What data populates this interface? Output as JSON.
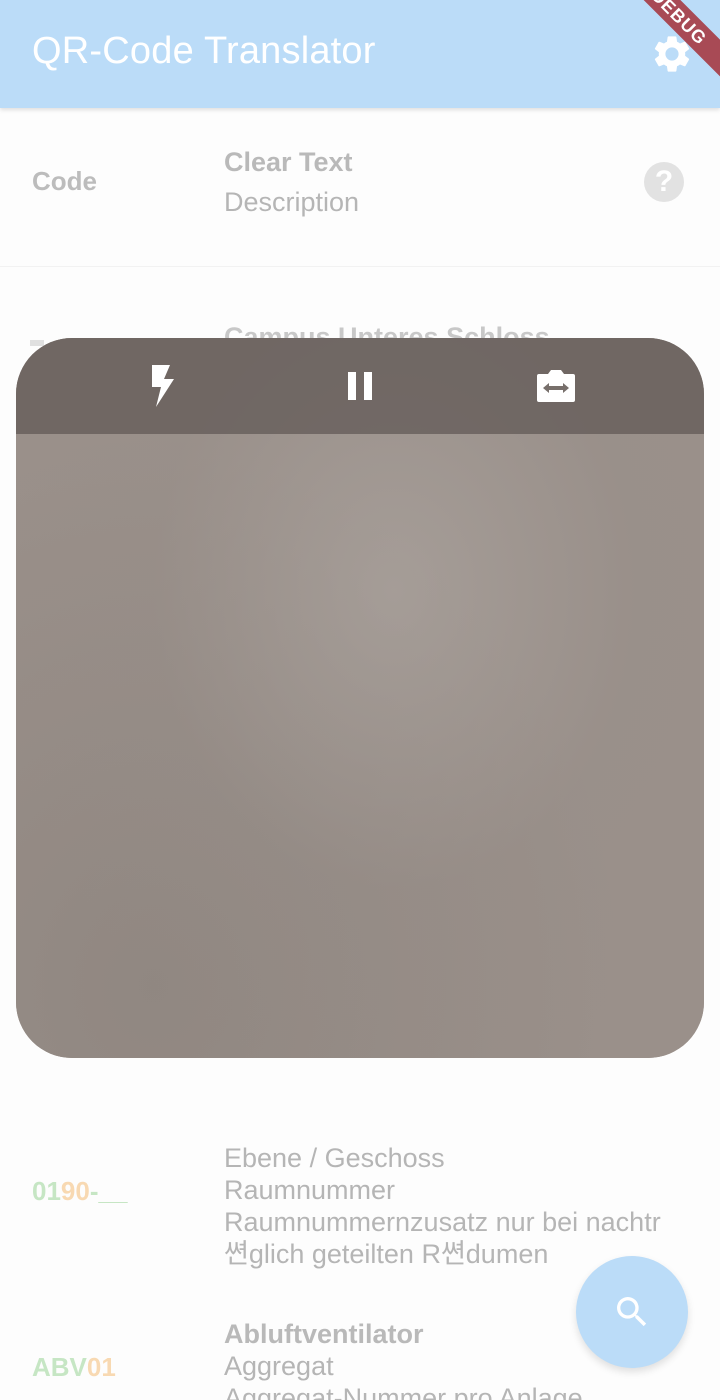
{
  "appbar": {
    "title": "QR-Code Translator",
    "settings_icon": "gear-icon",
    "debug_banner": "DEBUG"
  },
  "header_row": {
    "code_label": "Code",
    "clear_text_label": "Clear Text",
    "description_label": "Description",
    "help_icon": "question-mark-icon",
    "help_glyph": "?"
  },
  "partial_row": {
    "text": "Campus Unteres Schloss"
  },
  "scanner": {
    "flash_icon": "flash-icon",
    "pause_icon": "pause-icon",
    "switch_camera_icon": "switch-camera-icon"
  },
  "rows": [
    {
      "code_parts": [
        "01",
        "90",
        "-__"
      ],
      "lines": [
        "Ebene / Geschoss",
        "Raumnummer",
        "Raumnummernzusatz nur bei nachtr",
        "쎤glich geteilten R쎤dumen"
      ]
    },
    {
      "code_parts": [
        "ABV",
        "01"
      ],
      "title": "Abluftventilator",
      "lines": [
        "Aggregat",
        "Aggregat-Nummer pro Anlage"
      ]
    }
  ],
  "fab": {
    "icon": "search-icon"
  },
  "colors": {
    "appbar": "#bbdcf8",
    "code_green": "#c6e6c4",
    "code_orange": "#f8d9b2",
    "debug_banner": "#a84a55"
  }
}
